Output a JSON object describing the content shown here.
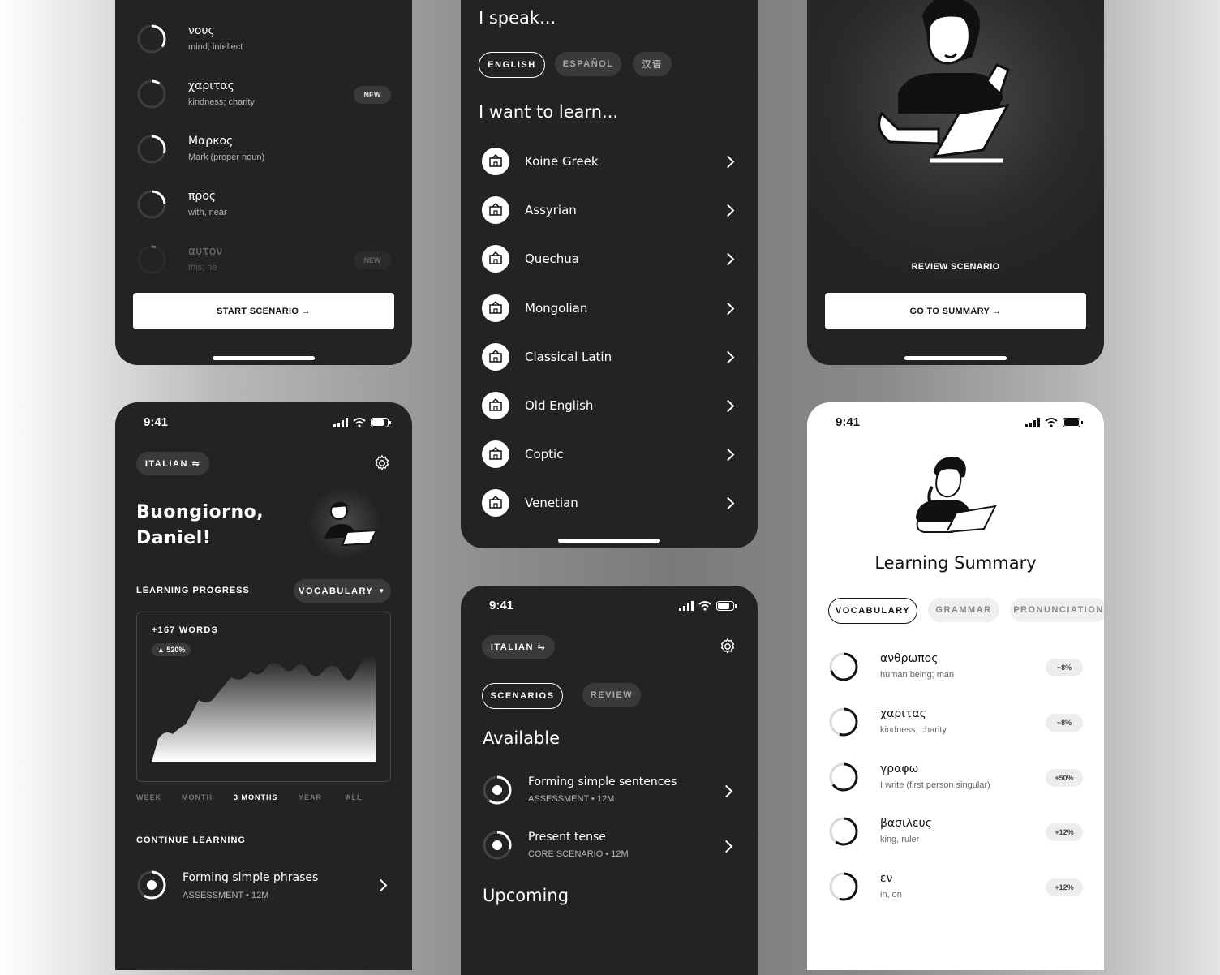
{
  "colors": {
    "phone_dark": "#232323",
    "accent_white": "#ffffff",
    "muted": "#b5b5b5"
  },
  "vocab_list": {
    "items": [
      {
        "word": "νους",
        "def": "mind; intellect",
        "progress": 0.35,
        "badge": ""
      },
      {
        "word": "χαριτας",
        "def": "kindness; charity",
        "progress": 0.1,
        "badge": "NEW"
      },
      {
        "word": "Μαρκος",
        "def": "Mark (proper noun)",
        "progress": 0.3,
        "badge": ""
      },
      {
        "word": "προς",
        "def": "with, near",
        "progress": 0.25,
        "badge": ""
      },
      {
        "word": "αυτον",
        "def": "this; he",
        "progress": 0.05,
        "badge": "NEW"
      }
    ],
    "start_button": "START SCENARIO →"
  },
  "language_select": {
    "speak_title": "I speak...",
    "speak_options": [
      "ENGLISH",
      "ESPAÑOL",
      "汉语"
    ],
    "learn_title": "I want to learn...",
    "languages": [
      {
        "name": "Koine Greek",
        "icon": "greek-pattern-icon"
      },
      {
        "name": "Assyrian",
        "icon": "ziggurat-icon"
      },
      {
        "name": "Quechua",
        "icon": "machu-picchu-icon"
      },
      {
        "name": "Mongolian",
        "icon": "yurt-icon"
      },
      {
        "name": "Classical Latin",
        "icon": "colosseum-icon"
      },
      {
        "name": "Old English",
        "icon": "castle-icon"
      },
      {
        "name": "Coptic",
        "icon": "church-icon"
      },
      {
        "name": "Venetian",
        "icon": "gondola-icon"
      }
    ]
  },
  "review": {
    "label": "REVIEW SCENARIO",
    "button": "GO TO SUMMARY →"
  },
  "home": {
    "time": "9:41",
    "language_pill": "ITALIAN ⇋",
    "greeting": "Buongiorno, Daniel!",
    "progress_label": "LEARNING PROGRESS",
    "dropdown": "VOCABULARY",
    "words": "+167 WORDS",
    "delta": "▲ 520%",
    "periods": [
      "WEEK",
      "MONTH",
      "3 MONTHS",
      "YEAR",
      "ALL"
    ],
    "selected_period": "3 MONTHS",
    "continue_label": "CONTINUE LEARNING",
    "continue_item": {
      "title": "Forming simple phrases",
      "sub": "ASSESSMENT • 12M"
    }
  },
  "scenarios": {
    "time": "9:41",
    "language_pill": "ITALIAN ⇋",
    "tabs": [
      "SCENARIOS",
      "REVIEW"
    ],
    "available_title": "Available",
    "items": [
      {
        "title": "Forming simple sentences",
        "sub": "ASSESSMENT • 12M",
        "progress": 0.6
      },
      {
        "title": "Present tense",
        "sub": "CORE SCENARIO • 12M",
        "progress": 0.3
      }
    ],
    "upcoming_title": "Upcoming"
  },
  "summary": {
    "time": "9:41",
    "title": "Learning Summary",
    "tabs": [
      "VOCABULARY",
      "GRAMMAR",
      "PRONUNCIATION"
    ],
    "items": [
      {
        "word": "ανθρωπος",
        "def": "human being; man",
        "badge": "+8%",
        "progress": 0.7
      },
      {
        "word": "χαριτας",
        "def": "kindness; charity",
        "badge": "+8%",
        "progress": 0.55
      },
      {
        "word": "γραφω",
        "def": "I write (first person singular)",
        "badge": "+50%",
        "progress": 0.65
      },
      {
        "word": "βασιλευς",
        "def": "king, ruler",
        "badge": "+12%",
        "progress": 0.6
      },
      {
        "word": "εν",
        "def": "in, on",
        "badge": "+12%",
        "progress": 0.55
      }
    ]
  }
}
